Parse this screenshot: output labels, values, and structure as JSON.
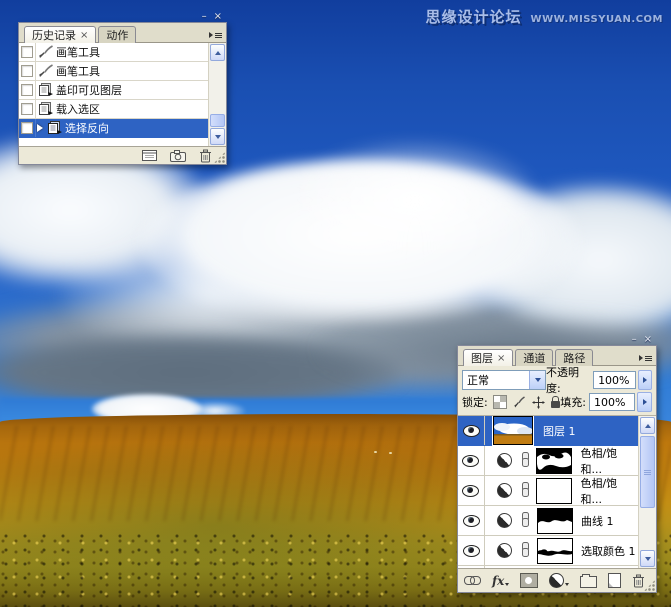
{
  "watermark": {
    "site": "思缘设计论坛",
    "url": "WWW.MISSYUAN.COM"
  },
  "window": {
    "minimize": "–",
    "close": "×"
  },
  "history_panel": {
    "tabs": {
      "history": "历史记录",
      "history_close": "×",
      "actions": "动作"
    },
    "items": [
      {
        "label": "画笔工具"
      },
      {
        "label": "画笔工具"
      },
      {
        "label": "盖印可见图层"
      },
      {
        "label": "载入选区"
      },
      {
        "label": "选择反向"
      }
    ]
  },
  "layers_panel": {
    "tabs": {
      "layers": "图层",
      "layers_close": "×",
      "channels": "通道",
      "paths": "路径"
    },
    "blend_mode": "正常",
    "opacity_label": "不透明度:",
    "opacity_value": "100%",
    "lock_label": "锁定:",
    "fill_label": "填充:",
    "fill_value": "100%",
    "fx_label": "fx",
    "layers": [
      {
        "name": "图层 1"
      },
      {
        "name": "色相/饱和..."
      },
      {
        "name": "色相/饱和..."
      },
      {
        "name": "曲线 1"
      },
      {
        "name": "选取颜色 1"
      }
    ]
  },
  "colors": {
    "selection_blue": "#2e63c3",
    "panel_bg": "#ece9d8",
    "sky_deep": "#1a4fb2",
    "land_orange": "#cc830f"
  }
}
